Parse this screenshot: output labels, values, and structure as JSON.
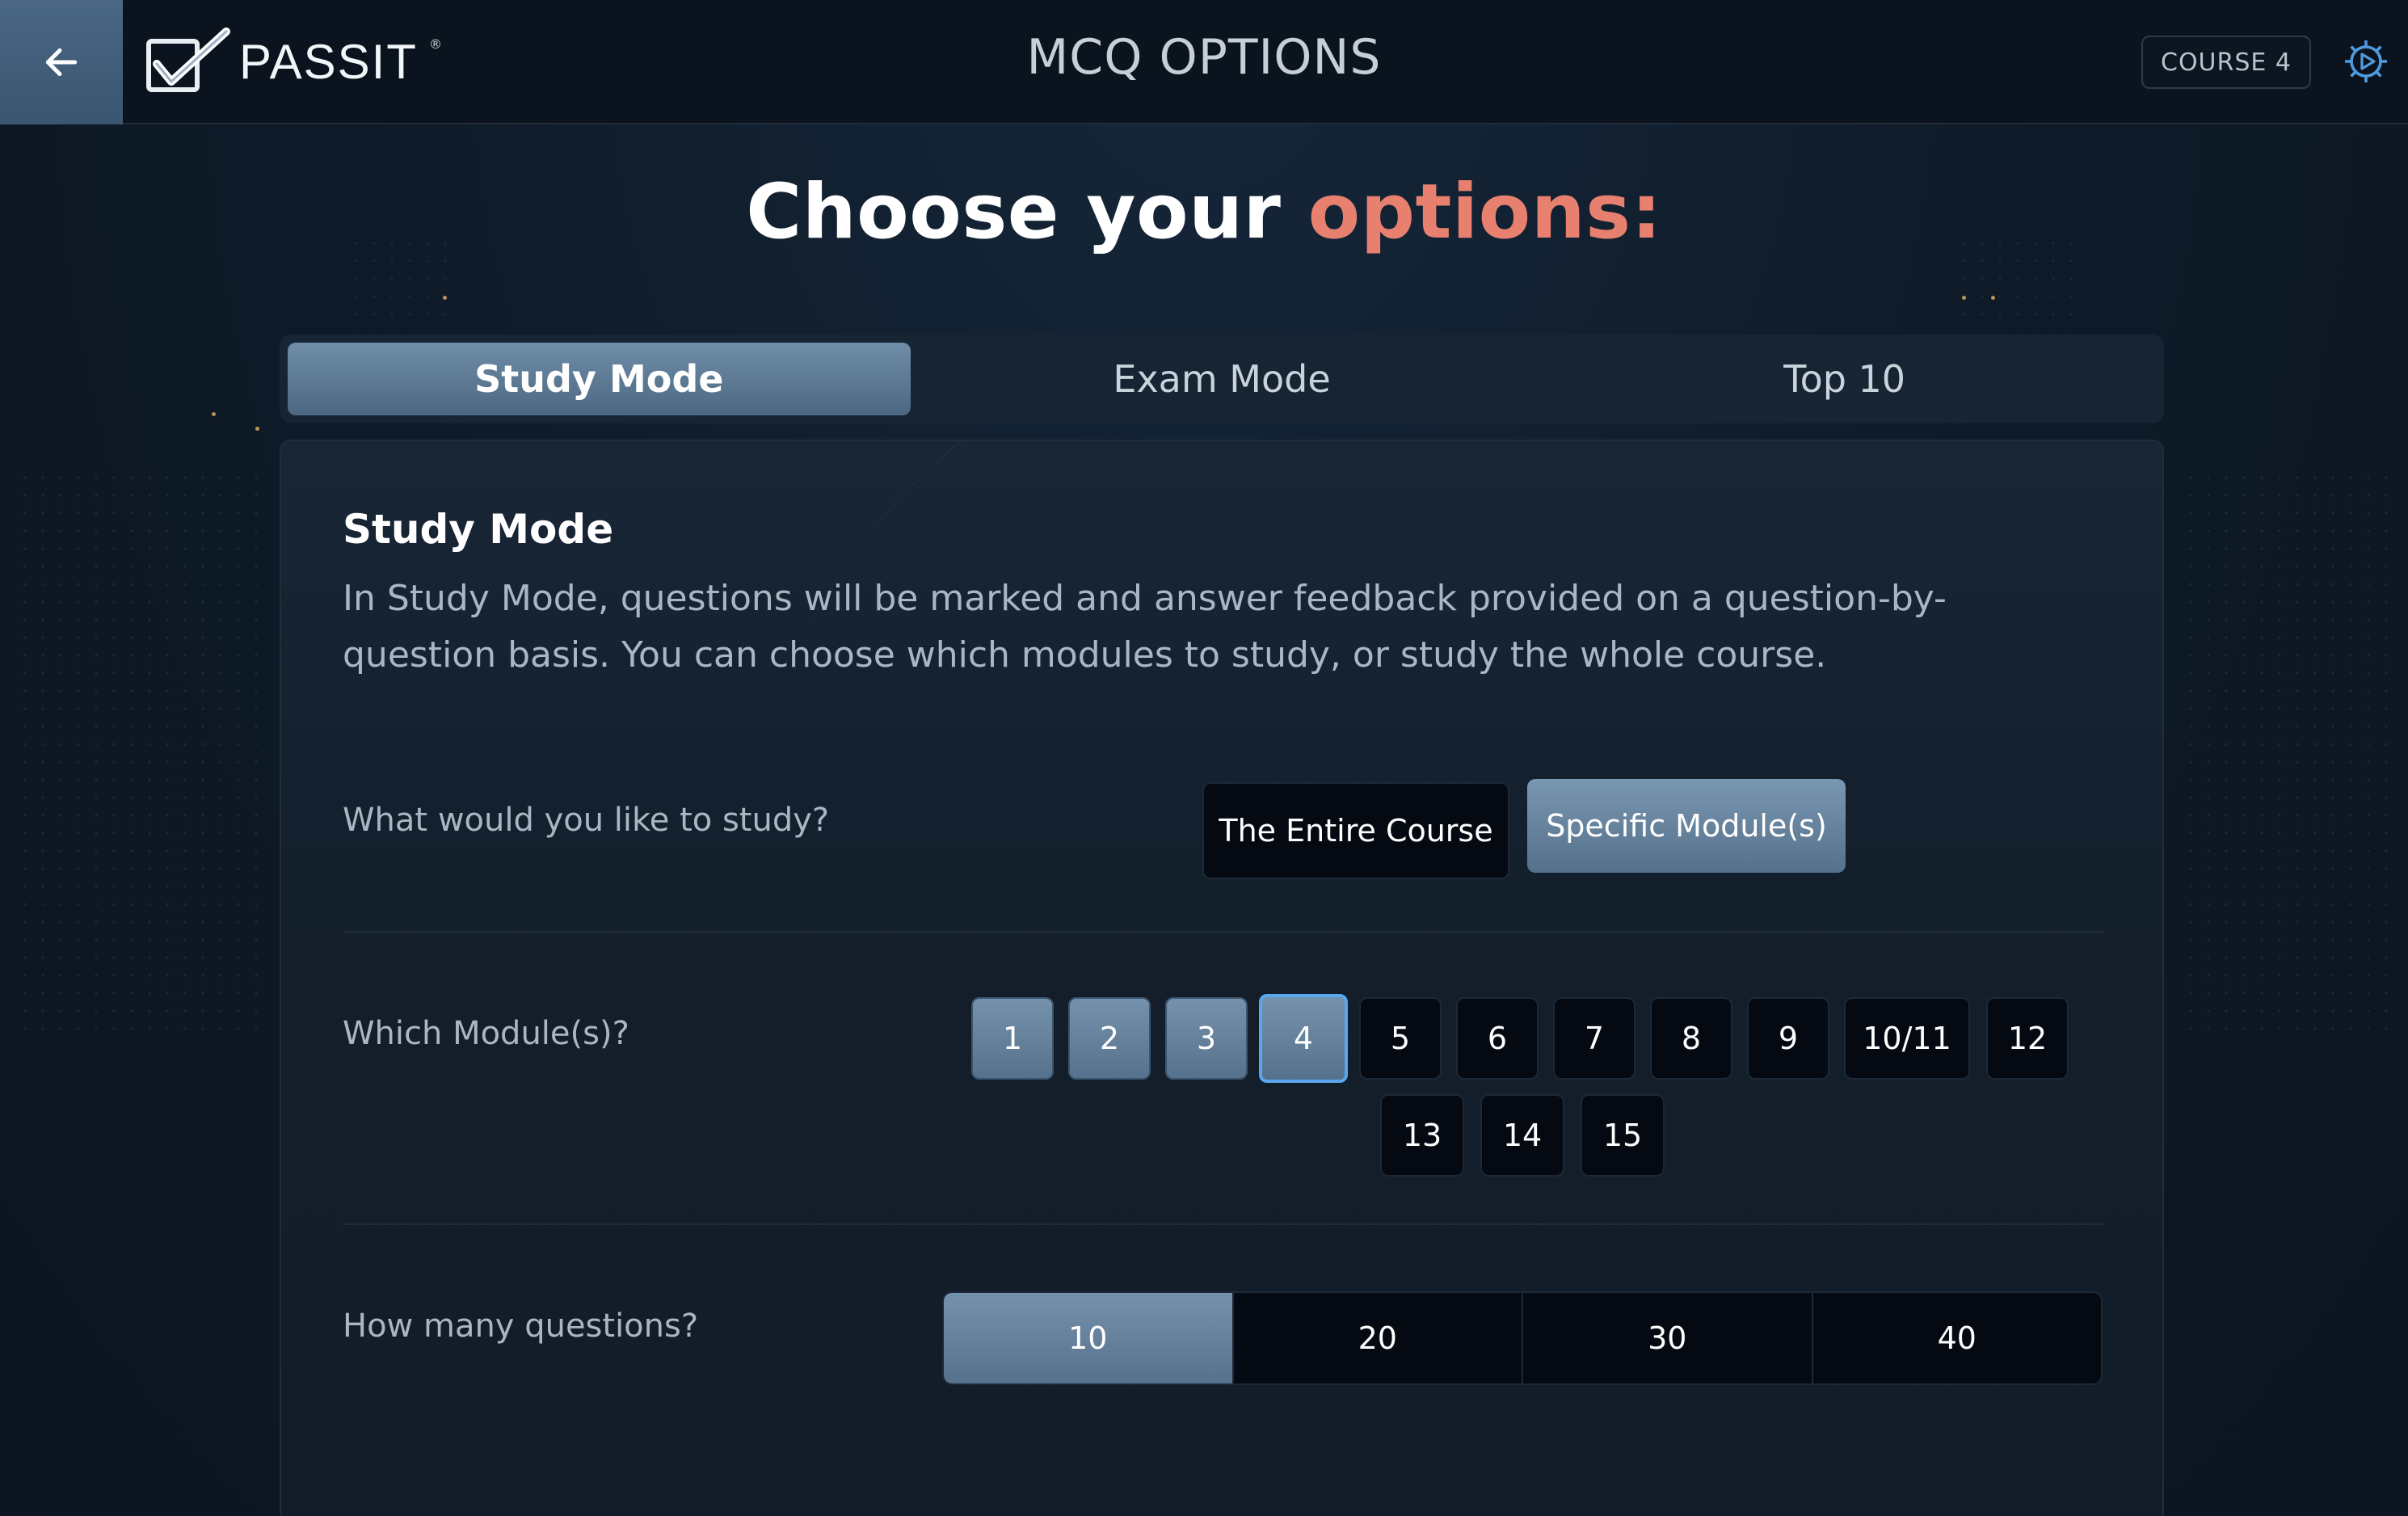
{
  "header": {
    "logo_text": "PASSIT",
    "logo_mark": "®",
    "title": "MCQ OPTIONS",
    "course_badge": "COURSE 4",
    "icons": {
      "back": "arrow-left-icon",
      "logo": "checkmark-box-icon",
      "settings": "gear-play-icon"
    }
  },
  "heading": {
    "prefix": "Choose your ",
    "accent": "options:",
    "accent_color": "#e8806f"
  },
  "tabs": [
    {
      "label": "Study Mode",
      "active": true
    },
    {
      "label": "Exam Mode",
      "active": false
    },
    {
      "label": "Top 10",
      "active": false
    }
  ],
  "panel": {
    "title": "Study Mode",
    "description": "In Study Mode, questions will be marked and answer feedback provided on a question-by-question basis. You can choose which modules to study, or study the whole course.",
    "study_scope": {
      "label": "What would you like to study?",
      "options": [
        {
          "label": "The Entire Course",
          "selected": false
        },
        {
          "label": "Specific Module(s)",
          "selected": true
        }
      ]
    },
    "modules": {
      "label": "Which Module(s)?",
      "items": [
        {
          "label": "1",
          "selected": true
        },
        {
          "label": "2",
          "selected": true
        },
        {
          "label": "3",
          "selected": true
        },
        {
          "label": "4",
          "selected": true,
          "focused": true
        },
        {
          "label": "5",
          "selected": false
        },
        {
          "label": "6",
          "selected": false
        },
        {
          "label": "7",
          "selected": false
        },
        {
          "label": "8",
          "selected": false
        },
        {
          "label": "9",
          "selected": false
        },
        {
          "label": "10/11",
          "selected": false
        },
        {
          "label": "12",
          "selected": false
        },
        {
          "label": "13",
          "selected": false
        },
        {
          "label": "14",
          "selected": false
        },
        {
          "label": "15",
          "selected": false
        }
      ]
    },
    "questions": {
      "label": "How many questions?",
      "options": [
        {
          "label": "10",
          "selected": true
        },
        {
          "label": "20",
          "selected": false
        },
        {
          "label": "30",
          "selected": false
        },
        {
          "label": "40",
          "selected": false
        }
      ]
    }
  },
  "colors": {
    "accent_blue": "#59a7ee",
    "selected_fill": "#6a88a4",
    "dark_button": "#050a12"
  }
}
